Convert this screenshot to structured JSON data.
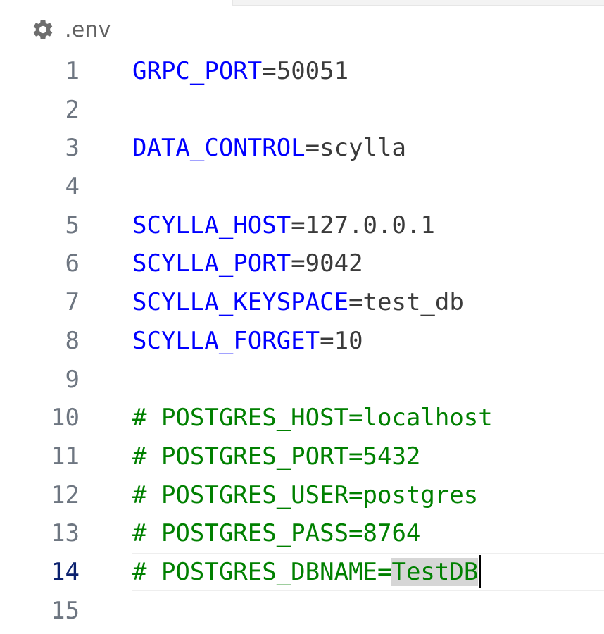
{
  "tab": {
    "file_name": ".env",
    "file_icon": "gear-icon"
  },
  "editor": {
    "current_line": 14,
    "lines": [
      {
        "num": "1",
        "key": "GRPC_PORT",
        "eq": "=",
        "val": "50051"
      },
      {
        "num": "2"
      },
      {
        "num": "3",
        "key": "DATA_CONTROL",
        "eq": "=",
        "val": "scylla"
      },
      {
        "num": "4"
      },
      {
        "num": "5",
        "key": "SCYLLA_HOST",
        "eq": "=",
        "val": "127.0.0.1"
      },
      {
        "num": "6",
        "key": "SCYLLA_PORT",
        "eq": "=",
        "val": "9042"
      },
      {
        "num": "7",
        "key": "SCYLLA_KEYSPACE",
        "eq": "=",
        "val": "test_db"
      },
      {
        "num": "8",
        "key": "SCYLLA_FORGET",
        "eq": "=",
        "val": "10"
      },
      {
        "num": "9"
      },
      {
        "num": "10",
        "comment": "# POSTGRES_HOST=localhost"
      },
      {
        "num": "11",
        "comment": "# POSTGRES_PORT=5432"
      },
      {
        "num": "12",
        "comment": "# POSTGRES_USER=postgres"
      },
      {
        "num": "13",
        "comment": "# POSTGRES_PASS=8764"
      },
      {
        "num": "14",
        "comment": "# POSTGRES_DBNAME=",
        "selected": "TestDB"
      },
      {
        "num": "15"
      }
    ]
  },
  "colors": {
    "key": "#0000ff",
    "value": "#3b3b3b",
    "comment": "#008000",
    "line_number": "#6e7681",
    "active_line_number": "#0b216f",
    "selection": "#d6d6d6"
  }
}
